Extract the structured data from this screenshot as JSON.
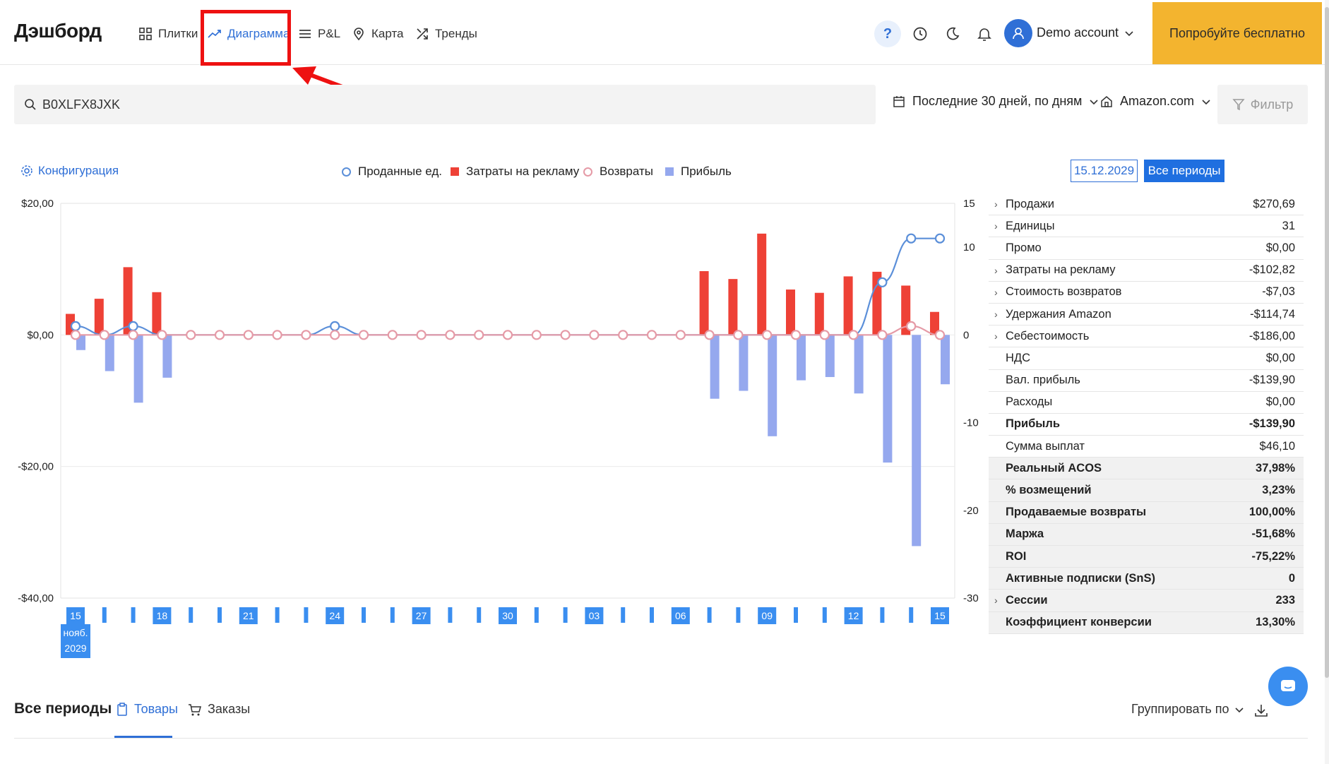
{
  "header": {
    "title": "Дэшборд",
    "nav": [
      {
        "label": "Плитки",
        "icon": "grid-icon"
      },
      {
        "label": "Диаграмма",
        "icon": "line-chart-icon",
        "active": true
      },
      {
        "label": "P&L",
        "icon": "list-icon"
      },
      {
        "label": "Карта",
        "icon": "map-pin-icon"
      },
      {
        "label": "Тренды",
        "icon": "shuffle-icon"
      }
    ],
    "help": "?",
    "account": "Demo account",
    "cta": "Попробуйте бесплатно",
    "accent_color": "#2f6fd6",
    "cta_color": "#f3b42f"
  },
  "toolbar": {
    "search_value": "B0XLFX8JXK",
    "period": "Последние 30 дней, по дням",
    "marketplace": "Amazon.com",
    "filter": "Фильтр"
  },
  "chart_header": {
    "config": "Конфигурация",
    "legend": [
      {
        "label": "Проданные ед.",
        "color": "#5b8fd9",
        "kind": "ring"
      },
      {
        "label": "Затраты на рекламу",
        "color": "#ee4136",
        "kind": "square"
      },
      {
        "label": "Возвраты",
        "color": "#e59aa6",
        "kind": "ring"
      },
      {
        "label": "Прибыль",
        "color": "#95a8ee",
        "kind": "square"
      }
    ],
    "date": "15.12.2029",
    "all_periods": "Все периоды"
  },
  "chart_data": {
    "type": "bar",
    "title": "",
    "left_axis": {
      "ticks": [
        "$20,00",
        "$0,00",
        "-$20,00",
        "-$40,00"
      ],
      "min": -40,
      "max": 20
    },
    "right_axis": {
      "ticks": [
        "15",
        "10",
        "0",
        "-10",
        "-20",
        "-30"
      ],
      "min": -30,
      "max": 15
    },
    "x_labels": [
      "15",
      "18",
      "21",
      "24",
      "27",
      "30",
      "03",
      "06",
      "09",
      "12",
      "15"
    ],
    "x_label_indices": [
      0,
      3,
      6,
      9,
      12,
      15,
      18,
      21,
      24,
      27,
      30
    ],
    "x_sublabel": [
      "нояб.",
      "2029"
    ],
    "days": 31,
    "series": [
      {
        "name": "Затраты на рекламу",
        "color": "#ee4136",
        "values": [
          3.2,
          5.5,
          10.3,
          6.5,
          0,
          0,
          0,
          0,
          0,
          0,
          0,
          0,
          0,
          0,
          0,
          0,
          0,
          0,
          0,
          0,
          0,
          0,
          9.7,
          8.5,
          15.4,
          6.9,
          6.4,
          8.9,
          9.6,
          7.5,
          3.5
        ]
      },
      {
        "name": "Прибыль",
        "color": "#95a8ee",
        "values": [
          -2.3,
          -5.5,
          -10.3,
          -6.5,
          0,
          0,
          0,
          0,
          0,
          0,
          0,
          0,
          0,
          0,
          0,
          0,
          0,
          0,
          0,
          0,
          0,
          0,
          -9.7,
          -8.5,
          -15.4,
          -6.9,
          -6.4,
          -8.9,
          -19.4,
          -32.1,
          -7.5
        ]
      },
      {
        "name": "Проданные ед.",
        "color": "#5b8fd9",
        "values": [
          1,
          0,
          1,
          0,
          0,
          0,
          0,
          0,
          0,
          1,
          0,
          0,
          0,
          0,
          0,
          0,
          0,
          0,
          0,
          0,
          0,
          0,
          0,
          0,
          0,
          0,
          0,
          0,
          6,
          11,
          11
        ]
      },
      {
        "name": "Возвраты",
        "color": "#e59aa6",
        "values": [
          0,
          0,
          0,
          0,
          0,
          0,
          0,
          0,
          0,
          0,
          0,
          0,
          0,
          0,
          0,
          0,
          0,
          0,
          0,
          0,
          0,
          0,
          0,
          0,
          0,
          0,
          0,
          0,
          0,
          1,
          0
        ]
      }
    ]
  },
  "metrics": [
    {
      "label": "Продажи",
      "value": "$270,69",
      "chevron": true,
      "bold": false
    },
    {
      "label": "Единицы",
      "value": "31",
      "chevron": true,
      "bold": false
    },
    {
      "label": "Промо",
      "value": "$0,00",
      "chevron": false,
      "bold": false
    },
    {
      "label": "Затраты на рекламу",
      "value": "-$102,82",
      "chevron": true,
      "bold": false
    },
    {
      "label": "Стоимость возвратов",
      "value": "-$7,03",
      "chevron": true,
      "bold": false
    },
    {
      "label": "Удержания Amazon",
      "value": "-$114,74",
      "chevron": true,
      "bold": false
    },
    {
      "label": "Себестоимость",
      "value": "-$186,00",
      "chevron": true,
      "bold": false
    },
    {
      "label": "НДС",
      "value": "$0,00",
      "chevron": false,
      "bold": false
    },
    {
      "label": "Вал. прибыль",
      "value": "-$139,90",
      "chevron": false,
      "bold": false
    },
    {
      "label": "Расходы",
      "value": "$0,00",
      "chevron": false,
      "bold": false
    },
    {
      "label": "Прибыль",
      "value": "-$139,90",
      "chevron": false,
      "bold": true
    },
    {
      "label": "Сумма выплат",
      "value": "$46,10",
      "chevron": false,
      "bold": false
    },
    {
      "label": "Реальный ACOS",
      "value": "37,98%",
      "chevron": false,
      "bold": true,
      "shade": true
    },
    {
      "label": "% возмещений",
      "value": "3,23%",
      "chevron": false,
      "bold": true,
      "shade": true
    },
    {
      "label": "Продаваемые возвраты",
      "value": "100,00%",
      "chevron": false,
      "bold": true,
      "shade": true
    },
    {
      "label": "Маржа",
      "value": "-51,68%",
      "chevron": false,
      "bold": true,
      "shade": true
    },
    {
      "label": "ROI",
      "value": "-75,22%",
      "chevron": false,
      "bold": true,
      "shade": true
    },
    {
      "label": "Активные подписки (SnS)",
      "value": "0",
      "chevron": false,
      "bold": true,
      "shade": true
    },
    {
      "label": "Сессии",
      "value": "233",
      "chevron": true,
      "bold": true,
      "shade": true
    },
    {
      "label": "Коэффициент конверсии",
      "value": "13,30%",
      "chevron": false,
      "bold": true,
      "shade": true
    }
  ],
  "bottom": {
    "title": "Все периоды",
    "tabs": [
      {
        "label": "Товары",
        "icon": "clipboard-icon",
        "active": true
      },
      {
        "label": "Заказы",
        "icon": "cart-icon",
        "active": false
      }
    ],
    "group_by": "Группировать по"
  }
}
